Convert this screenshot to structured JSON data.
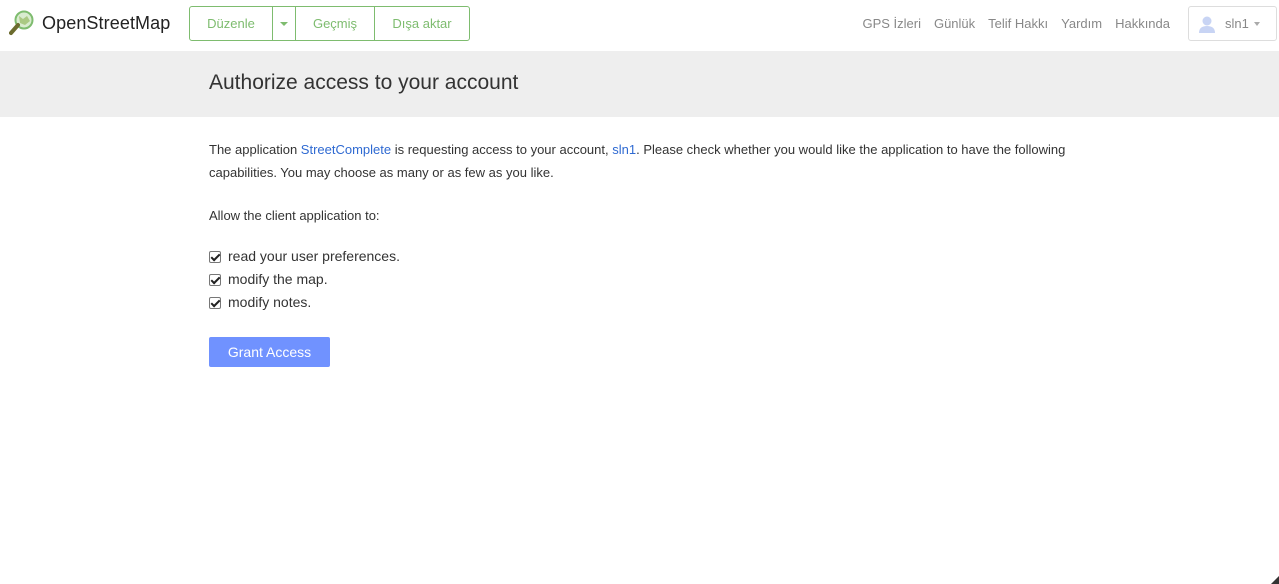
{
  "header": {
    "logo_text": "OpenStreetMap",
    "edit_label": "Düzenle",
    "history_label": "Geçmiş",
    "export_label": "Dışa aktar",
    "nav_links": [
      "GPS İzleri",
      "Günlük",
      "Telif Hakkı",
      "Yardım",
      "Hakkında"
    ],
    "user_name": "sln1"
  },
  "page": {
    "title": "Authorize access to your account",
    "intro_prefix": "The application ",
    "app_name": "StreetComplete",
    "intro_middle": " is requesting access to your account, ",
    "account_name": "sln1",
    "intro_suffix": ". Please check whether you would like the application to have the following capabilities. You may choose as many or as few as you like.",
    "allow_text": "Allow the client application to:",
    "capabilities": [
      {
        "label": "read your user preferences.",
        "checked": true
      },
      {
        "label": "modify the map.",
        "checked": true
      },
      {
        "label": "modify notes.",
        "checked": true
      }
    ],
    "grant_label": "Grant Access"
  },
  "colors": {
    "brand_green": "#7ebc6f",
    "link_blue": "#2f6ad2",
    "button_blue": "#7092ff",
    "title_bar_bg": "#eeeeee"
  },
  "icons": {
    "logo": "osm-magnifier-icon",
    "avatar": "user-silhouette-icon"
  }
}
